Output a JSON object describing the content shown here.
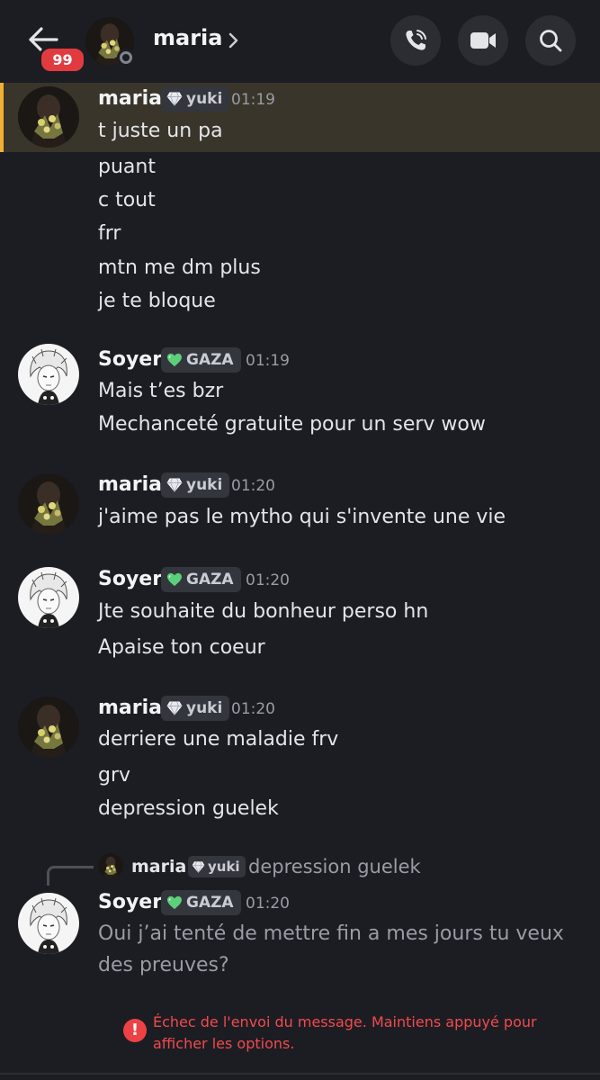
{
  "header": {
    "unread_count": "99",
    "title": "maria",
    "icons": [
      "back-arrow-icon",
      "chevron-right-icon",
      "phone-icon",
      "video-camera-icon",
      "search-icon"
    ]
  },
  "colors": {
    "background": "#1c1d22",
    "highlight_bg": "#39352a",
    "highlight_bar": "#f0b132",
    "badge": "#e13b40",
    "error": "#f04a4f"
  },
  "messages": [
    {
      "author": "maria",
      "tag": "yuki",
      "tag_icon": "diamond-icon",
      "time": "01:19",
      "lines": [
        "t juste un pa",
        "puant",
        "c tout",
        "frr",
        "mtn me dm plus",
        "je te bloque"
      ]
    },
    {
      "author": "Soyer",
      "tag": "GAZA",
      "tag_icon": "green-heart-icon",
      "time": "01:19",
      "lines": [
        "Mais t’es bzr",
        "Mechanceté gratuite pour un serv wow"
      ]
    },
    {
      "author": "maria",
      "tag": "yuki",
      "tag_icon": "diamond-icon",
      "time": "01:20",
      "lines": [
        "j'aime pas le mytho qui s'invente une vie"
      ]
    },
    {
      "author": "Soyer",
      "tag": "GAZA",
      "tag_icon": "green-heart-icon",
      "time": "01:20",
      "lines": [
        "Jte souhaite du bonheur perso hn",
        "Apaise ton coeur"
      ]
    },
    {
      "author": "maria",
      "tag": "yuki",
      "tag_icon": "diamond-icon",
      "time": "01:20",
      "lines": [
        "derriere une maladie frv",
        "grv",
        "depression guelek"
      ]
    },
    {
      "reply": {
        "author": "maria",
        "tag": "yuki",
        "text": "depression guelek"
      },
      "author": "Soyer",
      "tag": "GAZA",
      "tag_icon": "green-heart-icon",
      "time": "01:20",
      "lines": [
        "Oui j’ai tenté de mettre fin a mes jours tu veux des preuves?"
      ]
    }
  ],
  "error": {
    "text": "Échec de l'envoi du message. Maintiens appuyé pour afficher les options."
  }
}
